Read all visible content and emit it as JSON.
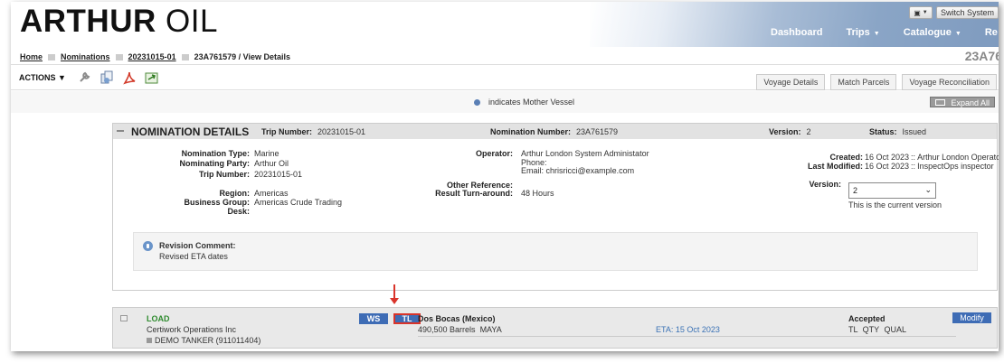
{
  "header": {
    "logo_bold": "ARTHUR",
    "logo_thin": "OIL",
    "switch_system": "Switch System",
    "nav": [
      "Dashboard",
      "Trips",
      "Catalogue",
      "Re"
    ]
  },
  "breadcrumb": {
    "items": [
      "Home",
      "Nominations",
      "20231015-01"
    ],
    "current": "23A761579 / View Details",
    "right_text": "23A76"
  },
  "actions": {
    "label": "ACTIONS",
    "tabs": [
      "Voyage Details",
      "Match Parcels",
      "Voyage Reconciliation"
    ]
  },
  "legend": {
    "mother_vessel": "indicates Mother Vessel",
    "expand_all": "Expand All",
    "colors": {
      "mother_vessel_dot": "#5a7fb5"
    }
  },
  "nomination": {
    "title": "NOMINATION DETAILS",
    "trip_number_label": "Trip Number:",
    "trip_number": "20231015-01",
    "nomination_number_label": "Nomination Number:",
    "nomination_number": "23A761579",
    "version_label": "Version:",
    "version": "2",
    "status_label": "Status:",
    "status": "Issued",
    "fields": {
      "nomination_type_label": "Nomination Type:",
      "nomination_type": "Marine",
      "nominating_party_label": "Nominating Party:",
      "nominating_party": "Arthur Oil",
      "trip_number_label": "Trip Number:",
      "trip_number": "20231015-01",
      "region_label": "Region:",
      "region": "Americas",
      "business_group_label": "Business Group:",
      "business_group": "Americas Crude Trading",
      "desk_label": "Desk:",
      "operator_label": "Operator:",
      "operator": "Arthur London System Administator",
      "phone": "Phone:",
      "email": "Email: chrisricci@example.com",
      "other_reference_label": "Other Reference:",
      "result_turnaround_label": "Result Turn-around:",
      "result_turnaround": "48 Hours",
      "created_label": "Created:",
      "created": "16 Oct 2023",
      "created_by": "Arthur London Operator",
      "last_modified_label": "Last Modified:",
      "last_modified": "16 Oct 2023",
      "last_modified_by": "InspectOps inspector",
      "version_label": "Version:",
      "version_selected": "2",
      "version_note": "This is the current version"
    },
    "revision": {
      "title": "Revision Comment:",
      "text": "Revised ETA dates"
    }
  },
  "load": {
    "type": "LOAD",
    "company": "Certiwork Operations Inc",
    "vessel": "DEMO TANKER (911011404)",
    "badge_ws": "WS",
    "badge_tl": "TL",
    "port": "Dos Bocas (Mexico)",
    "quantity": "490,500 Barrels",
    "grade": "MAYA",
    "eta": "ETA: 15 Oct 2023",
    "status": "Accepted",
    "flags": "TL  QTY  QUAL",
    "modify": "Modify",
    "colors": {
      "load_type": "#2e8b2e",
      "badge": "#3e6cb5",
      "highlight": "#d9342b"
    }
  }
}
